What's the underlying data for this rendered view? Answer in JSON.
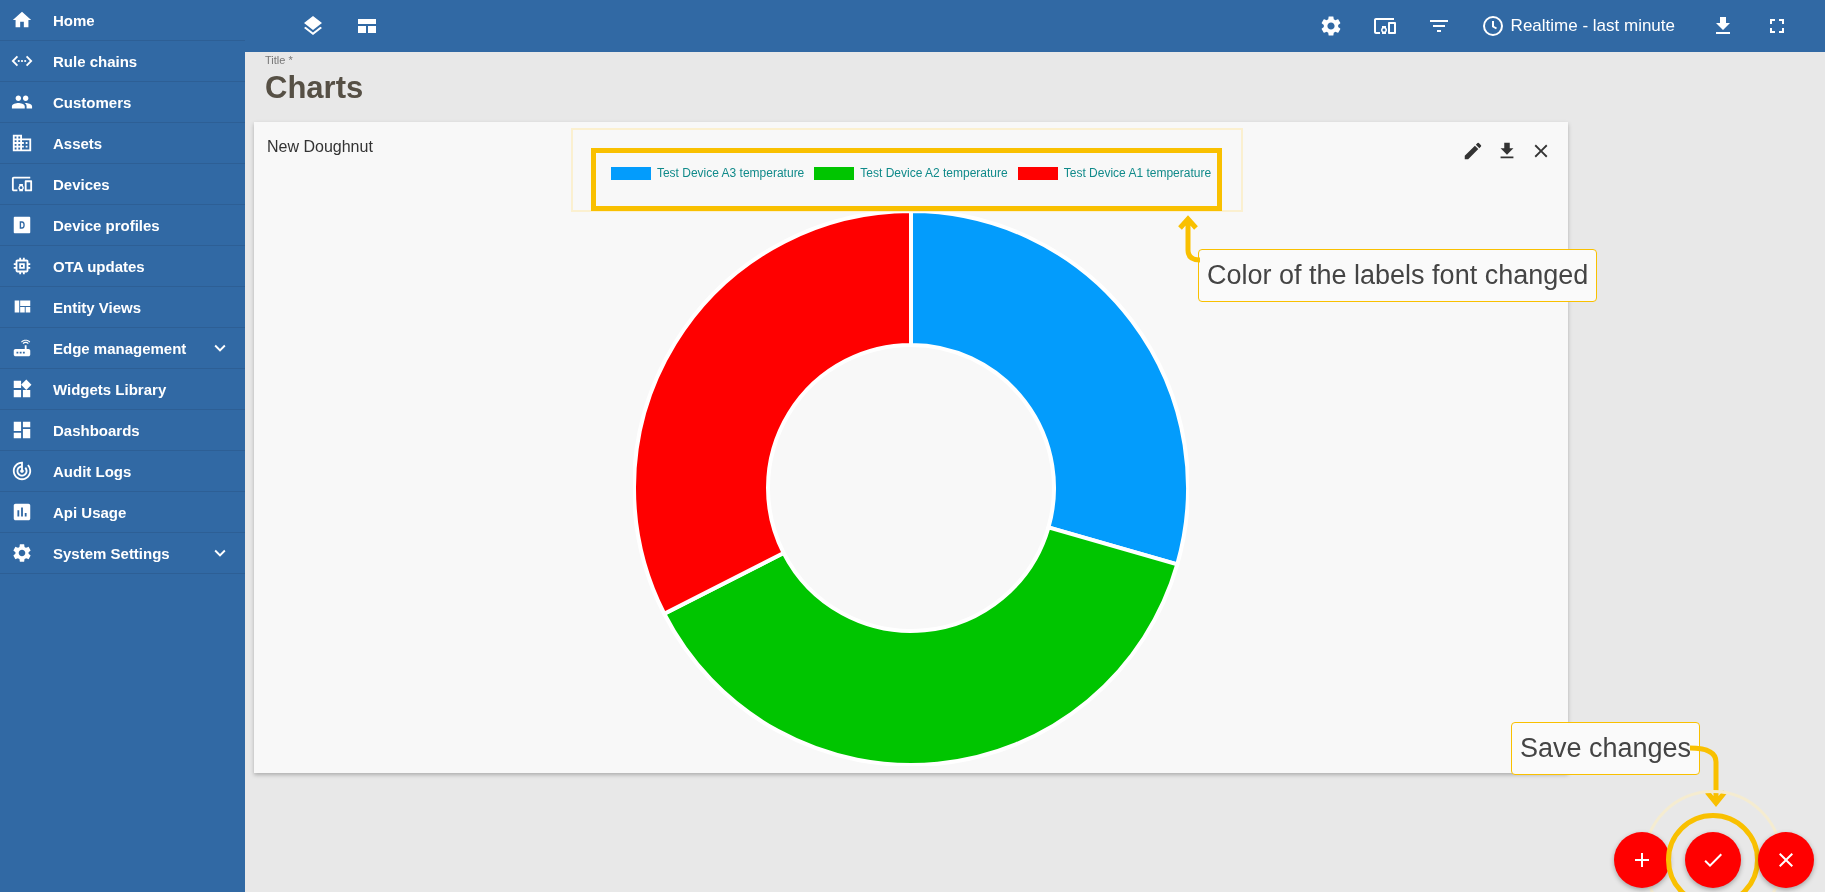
{
  "sidebar": {
    "items": [
      {
        "label": "Home",
        "has_submenu": false
      },
      {
        "label": "Rule chains",
        "has_submenu": false
      },
      {
        "label": "Customers",
        "has_submenu": false
      },
      {
        "label": "Assets",
        "has_submenu": false
      },
      {
        "label": "Devices",
        "has_submenu": false
      },
      {
        "label": "Device profiles",
        "has_submenu": false
      },
      {
        "label": "OTA updates",
        "has_submenu": false
      },
      {
        "label": "Entity Views",
        "has_submenu": false
      },
      {
        "label": "Edge management",
        "has_submenu": true
      },
      {
        "label": "Widgets Library",
        "has_submenu": false
      },
      {
        "label": "Dashboards",
        "has_submenu": false
      },
      {
        "label": "Audit Logs",
        "has_submenu": false
      },
      {
        "label": "Api Usage",
        "has_submenu": false
      },
      {
        "label": "System Settings",
        "has_submenu": true
      }
    ]
  },
  "toolbar": {
    "timewindow": "Realtime - last minute"
  },
  "dashboard_title": {
    "label": "Title *",
    "value": "Charts"
  },
  "widget": {
    "title": "New Doughnut",
    "legend": [
      {
        "label": "Test Device A3 temperature",
        "color": "#039cfc"
      },
      {
        "label": "Test Device A2 temperature",
        "color": "#00c500"
      },
      {
        "label": "Test Device A1 temperature",
        "color": "#ff0000"
      }
    ]
  },
  "annotations": [
    {
      "text": "Color of the labels font changed"
    },
    {
      "text": "Save changes"
    }
  ]
}
